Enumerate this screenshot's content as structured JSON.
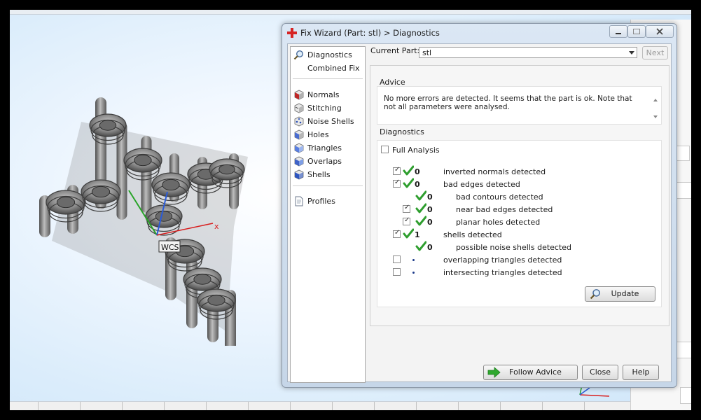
{
  "window": {
    "title": "Fix Wizard (Part: stl) > Diagnostics",
    "controls": {
      "minimize": "—",
      "maximize": "□",
      "close": "✕"
    }
  },
  "nav": {
    "items": [
      {
        "label": "Diagnostics",
        "icon": "magnifier-icon"
      },
      {
        "label": "Combined Fix",
        "icon": "combined-fix-icon"
      },
      {
        "label": "Normals",
        "icon": "normals-cube-icon"
      },
      {
        "label": "Stitching",
        "icon": "stitching-cube-icon"
      },
      {
        "label": "Noise Shells",
        "icon": "noise-shells-cube-icon"
      },
      {
        "label": "Holes",
        "icon": "holes-cube-icon"
      },
      {
        "label": "Triangles",
        "icon": "triangles-cube-icon"
      },
      {
        "label": "Overlaps",
        "icon": "overlaps-cube-icon"
      },
      {
        "label": "Shells",
        "icon": "shells-cube-icon"
      },
      {
        "label": "Profiles",
        "icon": "profiles-document-icon"
      }
    ]
  },
  "current_part": {
    "label": "Current Part:",
    "value": "stl"
  },
  "buttons": {
    "next": "Next",
    "update": "Update",
    "follow_advice": "Follow Advice",
    "close": "Close",
    "help": "Help"
  },
  "advice": {
    "label": "Advice",
    "text": "No more errors are detected. It seems that the part is ok. Note that not all parameters were analysed."
  },
  "diagnostics": {
    "label": "Diagnostics",
    "full_analysis": {
      "label": "Full Analysis",
      "checked": false
    },
    "rows": [
      {
        "label": "inverted normals detected",
        "count": "0",
        "checked": true,
        "status": "ok"
      },
      {
        "label": "bad edges detected",
        "count": "0",
        "checked": true,
        "status": "ok"
      },
      {
        "label": "bad contours detected",
        "count": "0",
        "checked": null,
        "status": "ok"
      },
      {
        "label": "near bad edges detected",
        "count": "0",
        "checked": true,
        "status": "ok"
      },
      {
        "label": "planar holes detected",
        "count": "0",
        "checked": true,
        "status": "ok"
      },
      {
        "label": "shells detected",
        "count": "1",
        "checked": true,
        "status": "ok"
      },
      {
        "label": "possible noise shells detected",
        "count": "0",
        "checked": null,
        "status": "ok"
      },
      {
        "label": "overlapping triangles detected",
        "count": "•",
        "checked": false,
        "status": "none"
      },
      {
        "label": "intersecting triangles detected",
        "count": "•",
        "checked": false,
        "status": "none"
      }
    ]
  },
  "viewport": {
    "wcs_label": "WCS",
    "x_axis_label": "x"
  },
  "colors": {
    "ok_check": "#2e9e2e",
    "axis_x": "#d81e1e",
    "axis_y": "#28a428",
    "axis_z": "#2a5bd8",
    "follow_arrow": "#2fa82f"
  }
}
